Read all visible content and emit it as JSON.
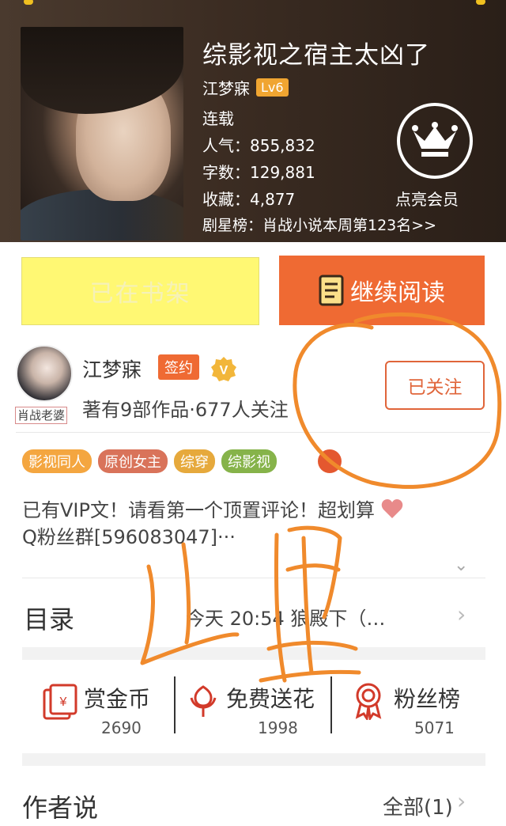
{
  "book": {
    "title": "综影视之宿主太凶了",
    "author": "江梦寐",
    "level": "Lv6",
    "status": "连载",
    "popularity": "人气：855,832",
    "word_count": "字数：129,881",
    "favorites": "收藏：4,877",
    "rank": "剧星榜：肖战小说本周第123名>>",
    "member_label": "点亮会员"
  },
  "actions": {
    "on_shelf": "已在书架",
    "continue_reading": "继续阅读"
  },
  "author_card": {
    "avatar_tag": "肖战老婆",
    "name": "江梦寐",
    "sign_tag": "签约",
    "v_badge": "V",
    "summary": "著有9部作品·677人关注",
    "follow_label": "已关注"
  },
  "tags": [
    {
      "label": "影视同人",
      "color": "#f4a640"
    },
    {
      "label": "原创女主",
      "color": "#d9735a"
    },
    {
      "label": "综穿",
      "color": "#e6a93c"
    },
    {
      "label": "综影视",
      "color": "#86b34a"
    }
  ],
  "description": {
    "line1": "已有VIP文！请看第一个顶置评论！超划算",
    "line2": "Q粉丝群[596083047]···"
  },
  "toc": {
    "label": "目录",
    "latest": "今天 20:54 狼殿下（…"
  },
  "funding": [
    {
      "label": "赏金币",
      "value": "2690",
      "icon": "red-envelope-icon"
    },
    {
      "label": "免费送花",
      "value": "1998",
      "icon": "flower-icon"
    },
    {
      "label": "粉丝榜",
      "value": "5071",
      "icon": "medal-icon"
    }
  ],
  "author_says": {
    "label": "作者说",
    "all_label": "全部(1)"
  },
  "annotation": {
    "handwritten_text": "这里",
    "color": "#f08a2c"
  }
}
